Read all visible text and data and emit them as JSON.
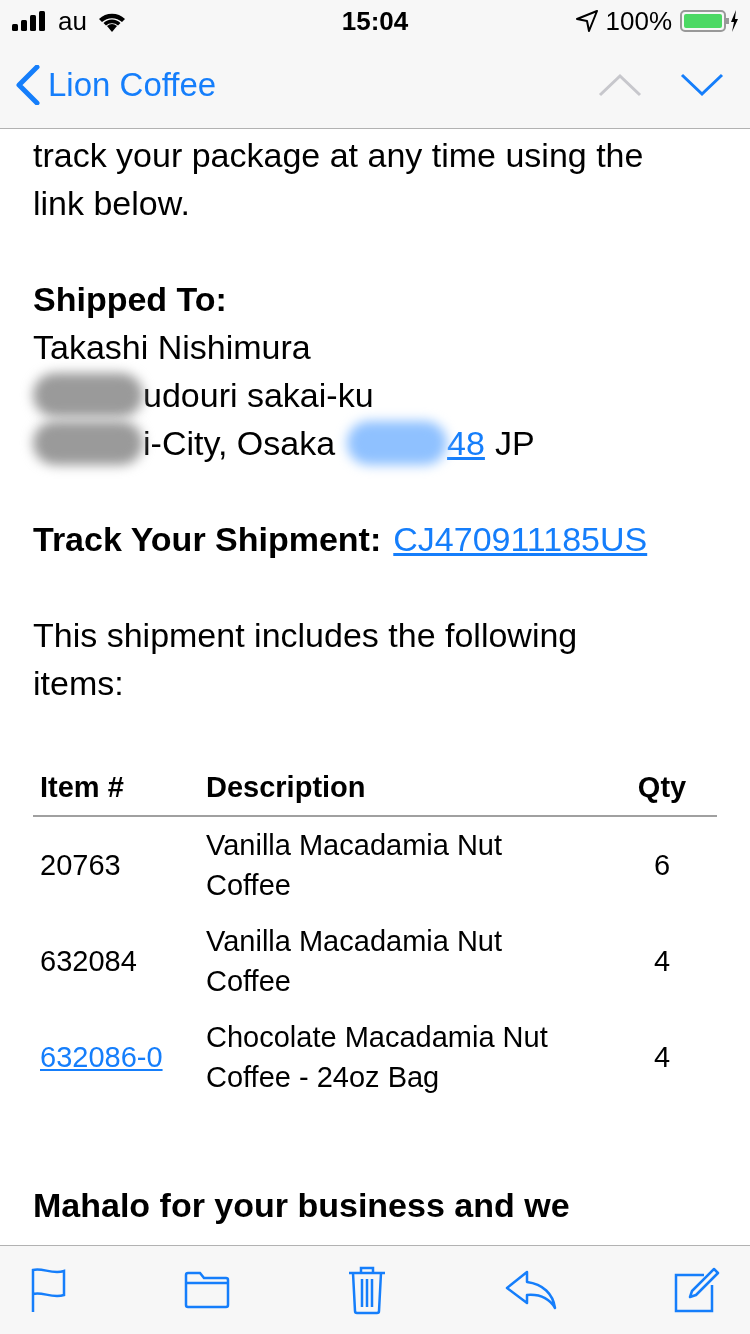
{
  "status_bar": {
    "carrier": "au",
    "time": "15:04",
    "battery": "100%"
  },
  "nav": {
    "back_label": "Lion Coffee",
    "prev_disabled": true,
    "next_disabled": false
  },
  "body": {
    "intro": "track your package at any time using the link below.",
    "shipped_heading": "Shipped To:",
    "address": [
      {
        "text": "Takashi Nishimura",
        "redacted": false
      },
      {
        "text": "udouri sakai-ku",
        "redacted": true
      },
      {
        "text": "i-City, Osaka",
        "redacted": true,
        "postal_link": "48",
        "suffix": "JP"
      }
    ],
    "track_label": "Track Your Shipment:",
    "track_link": "CJ470911185US",
    "includes": "This shipment includes the following items:",
    "table": {
      "columns": [
        "Item #",
        "Description",
        "Qty"
      ],
      "rows": [
        {
          "item": "20763",
          "link": false,
          "description": "Vanilla Macadamia Nut Coffee",
          "qty": "6"
        },
        {
          "item": "632084",
          "link": false,
          "description": "Vanilla Macadamia Nut Coffee",
          "qty": "4"
        },
        {
          "item": "632086-0",
          "link": true,
          "description": "Chocolate Macadamia Nut Coffee - 24oz Bag",
          "qty": "4"
        }
      ]
    },
    "closing": "Mahalo for your business and we"
  }
}
